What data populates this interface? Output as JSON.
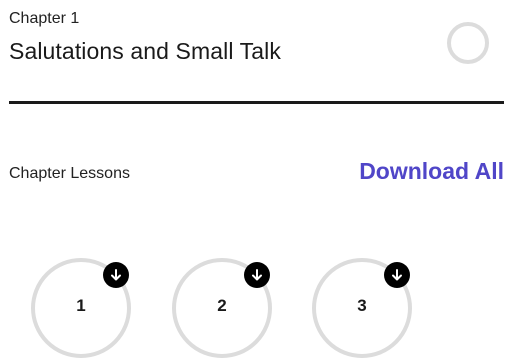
{
  "chapter": {
    "label": "Chapter 1",
    "title": "Salutations and Small Talk"
  },
  "lessons_section": {
    "label": "Chapter Lessons",
    "download_all": "Download All",
    "accent_color": "#5046c8"
  },
  "lessons": [
    {
      "number": "1",
      "icon": "download-arrow-icon"
    },
    {
      "number": "2",
      "icon": "download-arrow-icon"
    },
    {
      "number": "3",
      "icon": "download-arrow-icon"
    }
  ]
}
